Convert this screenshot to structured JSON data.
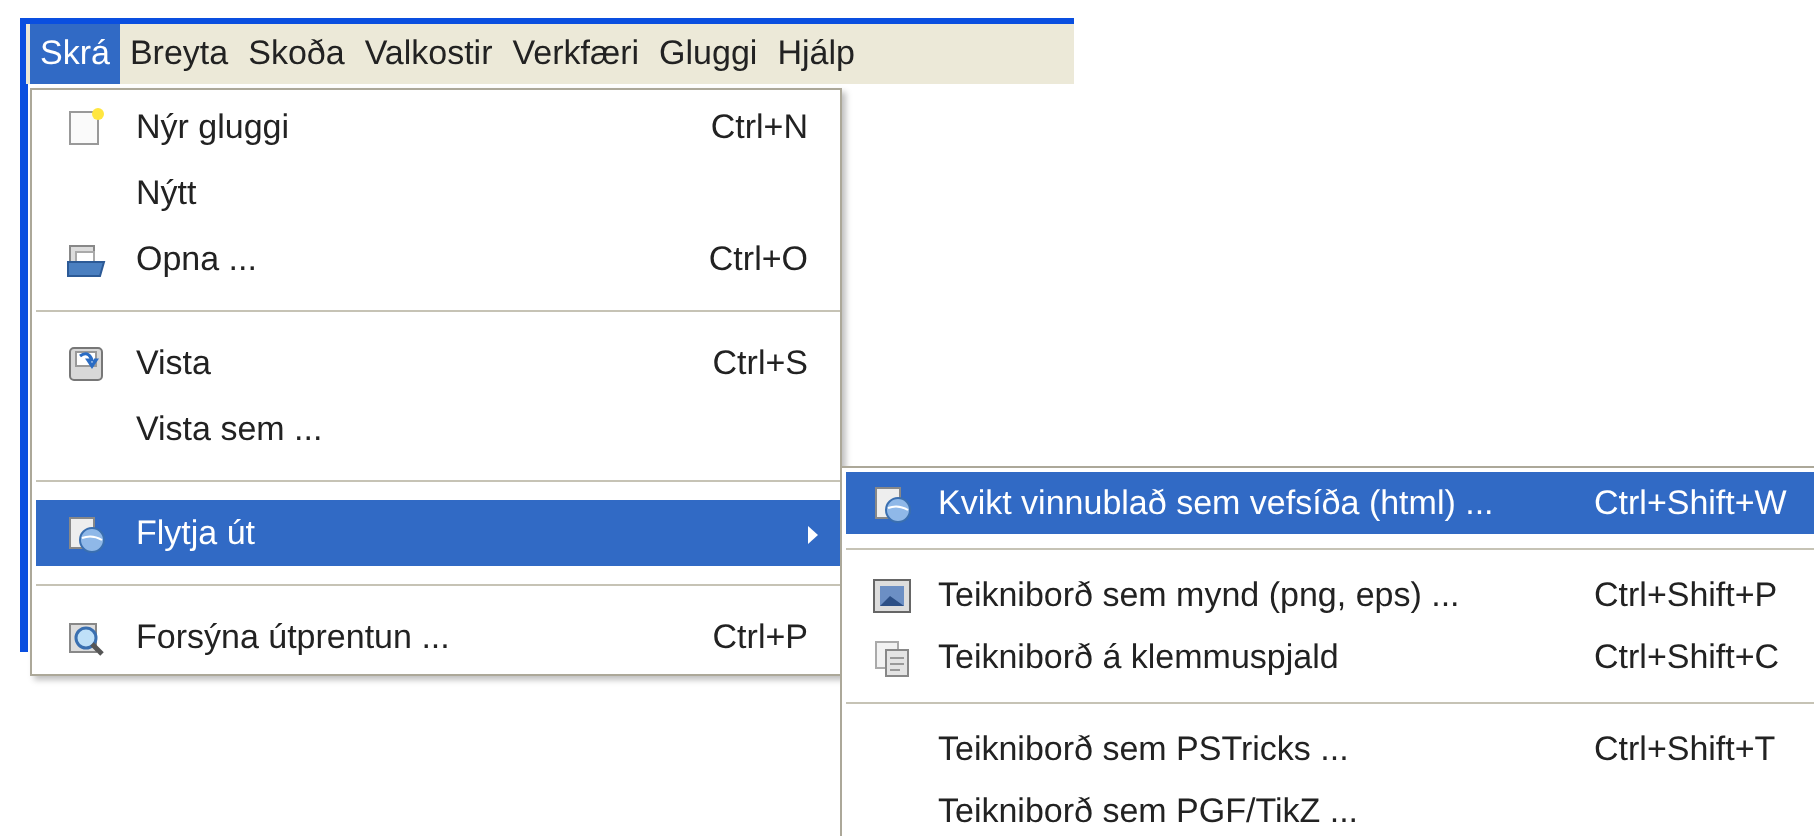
{
  "menubar": [
    {
      "label": "Skrá",
      "selected": true
    },
    {
      "label": "Breyta",
      "selected": false
    },
    {
      "label": "Skoða",
      "selected": false
    },
    {
      "label": "Valkostir",
      "selected": false
    },
    {
      "label": "Verkfæri",
      "selected": false
    },
    {
      "label": "Gluggi",
      "selected": false
    },
    {
      "label": "Hjálp",
      "selected": false
    }
  ],
  "file_menu": [
    {
      "kind": "page",
      "label": "Nýr gluggi",
      "shortcut": "Ctrl+N",
      "selected": false
    },
    {
      "kind": "plain",
      "label": "Nýtt",
      "selected": false
    },
    {
      "kind": "folder",
      "label": "Opna ...",
      "shortcut": "Ctrl+O",
      "selected": false
    },
    {
      "kind": "separator"
    },
    {
      "kind": "disk",
      "label": "Vista",
      "shortcut": "Ctrl+S",
      "selected": false
    },
    {
      "kind": "plain",
      "label": "Vista sem ...",
      "selected": false
    },
    {
      "kind": "separator"
    },
    {
      "kind": "export",
      "label": "Flytja út",
      "submenu": true,
      "selected": true
    },
    {
      "kind": "separator"
    },
    {
      "kind": "preview",
      "label": "Forsýna útprentun ...",
      "shortcut": "Ctrl+P",
      "selected": false
    }
  ],
  "export_submenu": [
    {
      "kind": "export",
      "label": "Kvikt vinnublað sem vefsíða (html) ...",
      "shortcut": "Ctrl+Shift+W",
      "selected": true
    },
    {
      "kind": "separator"
    },
    {
      "kind": "image",
      "label": "Teikniborð sem mynd (png, eps) ...",
      "shortcut": "Ctrl+Shift+P",
      "selected": false
    },
    {
      "kind": "copy",
      "label": "Teikniborð á klemmuspjald",
      "shortcut": "Ctrl+Shift+C",
      "selected": false
    },
    {
      "kind": "separator"
    },
    {
      "kind": "plain",
      "label": "Teikniborð sem PSTricks ...",
      "shortcut": "Ctrl+Shift+T",
      "selected": false
    },
    {
      "kind": "plain",
      "label": "Teikniborð sem PGF/TikZ ...",
      "selected": false
    }
  ]
}
